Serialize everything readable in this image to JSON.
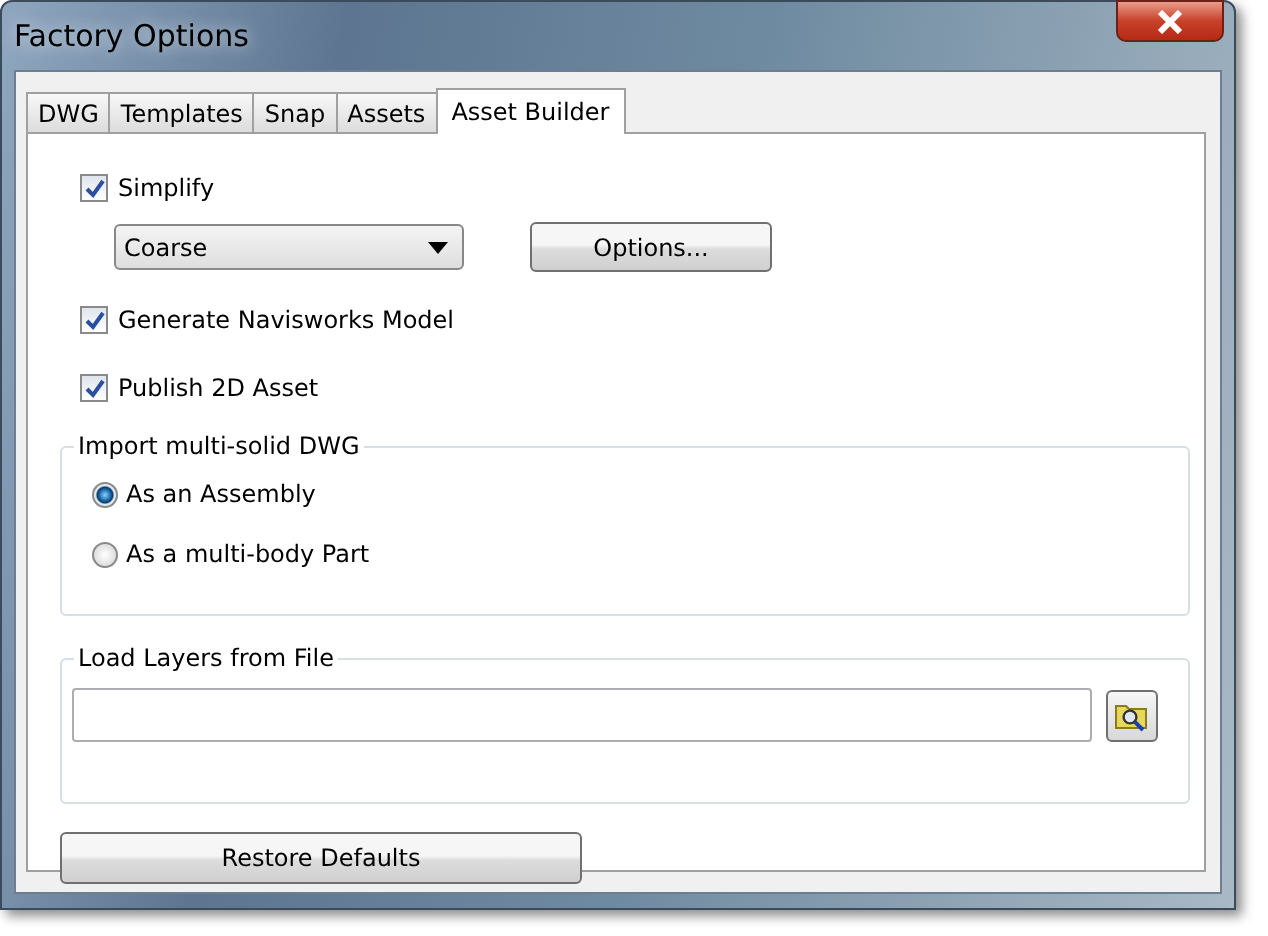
{
  "window": {
    "title": "Factory Options"
  },
  "tabs": [
    {
      "label": "DWG",
      "selected": false
    },
    {
      "label": "Templates",
      "selected": false
    },
    {
      "label": "Snap",
      "selected": false
    },
    {
      "label": "Assets",
      "selected": false
    },
    {
      "label": "Asset Builder",
      "selected": true
    }
  ],
  "simplify": {
    "label": "Simplify",
    "checked": true
  },
  "detail_dropdown": {
    "value": "Coarse"
  },
  "options_button": "Options...",
  "checkboxes": [
    {
      "label": "Generate Navisworks Model",
      "checked": true
    },
    {
      "label": "Publish 2D Asset",
      "checked": true
    }
  ],
  "import_group": {
    "title": "Import multi-solid DWG",
    "options": [
      {
        "label": "As an Assembly",
        "selected": true
      },
      {
        "label": "As a multi-body Part",
        "selected": false
      }
    ]
  },
  "layers_group": {
    "title": "Load Layers from File"
  },
  "restore_button": "Restore Defaults"
}
